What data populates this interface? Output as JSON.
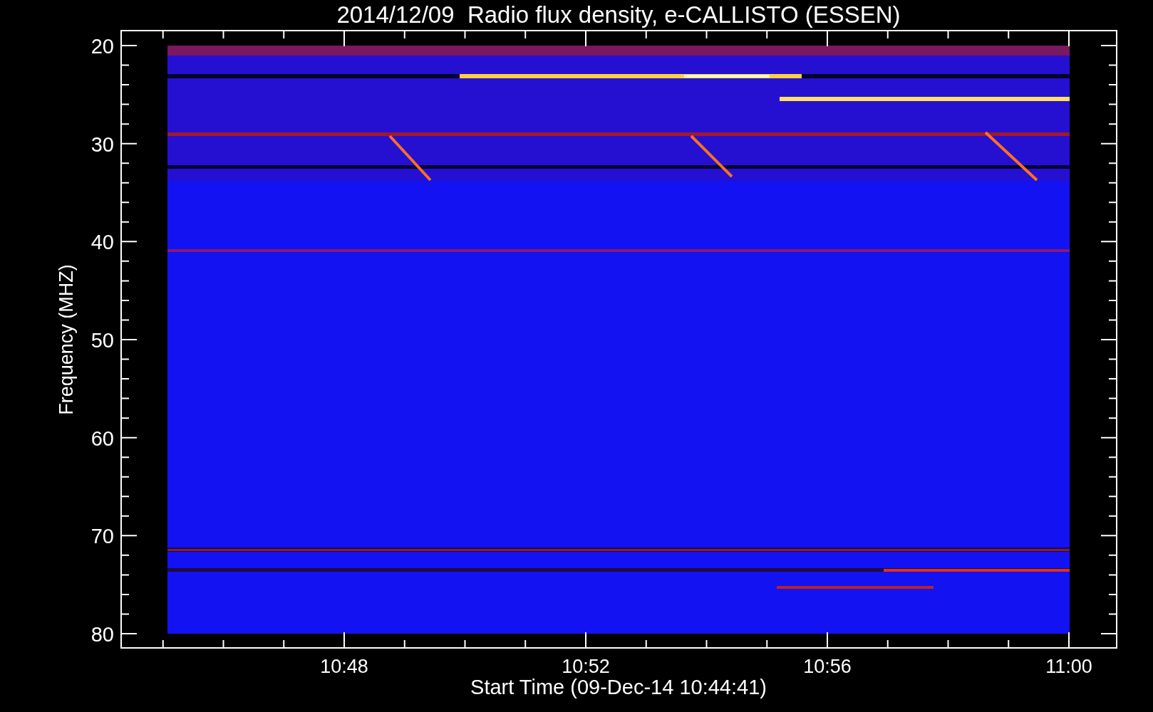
{
  "plot": {
    "title": "2014/12/09  Radio flux density, e-CALLISTO (ESSEN)",
    "y_axis": {
      "label": "Frequency (MHZ)",
      "ticks": [
        "20",
        "30",
        "40",
        "50",
        "60",
        "70",
        "80"
      ]
    },
    "x_axis": {
      "label": "Start Time (09-Dec-14 10:44:41)",
      "ticks": [
        "10:48",
        "10:52",
        "10:56",
        "11:00"
      ]
    },
    "image": {
      "kind": "spectrogram"
    }
  }
}
